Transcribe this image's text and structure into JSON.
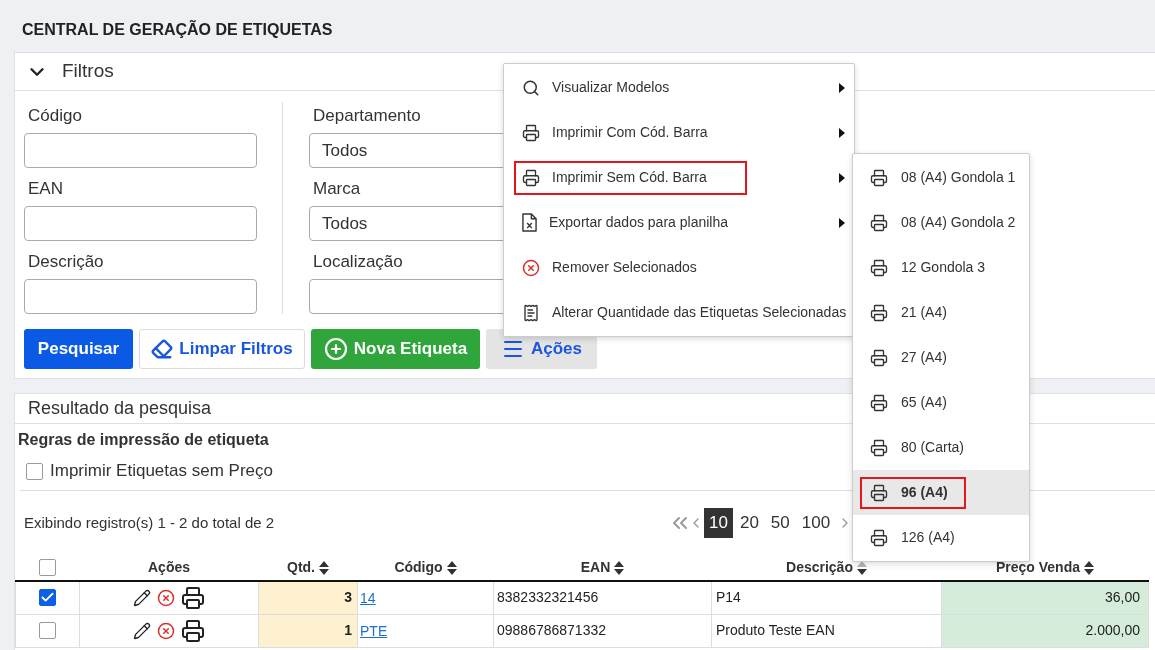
{
  "page": {
    "title": "CENTRAL DE GERAÇÃO DE ETIQUETAS"
  },
  "filters": {
    "title": "Filtros",
    "expanded": true,
    "columns": [
      {
        "fields": [
          {
            "label": "Código",
            "kind": "input"
          },
          {
            "label": "EAN",
            "kind": "input"
          },
          {
            "label": "Descrição",
            "kind": "input"
          }
        ]
      },
      {
        "fields": [
          {
            "label": "Departamento",
            "kind": "select",
            "value": "Todos"
          },
          {
            "label": "Marca",
            "kind": "select",
            "value": "Todos"
          },
          {
            "label": "Localização",
            "kind": "input"
          }
        ]
      }
    ],
    "buttons": [
      {
        "label": "Pesquisar",
        "kind": "search"
      },
      {
        "label": "Limpar Filtros",
        "kind": "clear"
      },
      {
        "label": "Nova Etiqueta",
        "kind": "new"
      },
      {
        "label": "Ações",
        "kind": "menu"
      }
    ]
  },
  "actions_menu": {
    "items": [
      {
        "label": "Visualizar Modelos",
        "kind": "view",
        "submenu": true,
        "outlined": false
      },
      {
        "label": "Imprimir Com Cód. Barra",
        "kind": "print",
        "submenu": true,
        "outlined": false
      },
      {
        "label": "Imprimir Sem Cód. Barra",
        "kind": "print",
        "submenu": true,
        "outlined": true
      },
      {
        "label": "Exportar dados para planilha",
        "kind": "export",
        "submenu": true,
        "outlined": false
      },
      {
        "label": "Remover Selecionados",
        "kind": "remove",
        "submenu": false,
        "outlined": false
      },
      {
        "label": "Alterar Quantidade das Etiquetas Selecionadas",
        "kind": "quantity",
        "submenu": false,
        "outlined": false
      }
    ]
  },
  "submenu": {
    "items": [
      {
        "label": "08 (A4) Gondola 1",
        "selected": false,
        "outlined": false
      },
      {
        "label": "08 (A4) Gondola 2",
        "selected": false,
        "outlined": false
      },
      {
        "label": "12 Gondola 3",
        "selected": false,
        "outlined": false
      },
      {
        "label": "21 (A4)",
        "selected": false,
        "outlined": false
      },
      {
        "label": "27 (A4)",
        "selected": false,
        "outlined": false
      },
      {
        "label": "65 (A4)",
        "selected": false,
        "outlined": false
      },
      {
        "label": "80 (Carta)",
        "selected": false,
        "outlined": false
      },
      {
        "label": "96 (A4)",
        "selected": true,
        "outlined": true
      },
      {
        "label": "126 (A4)",
        "selected": false,
        "outlined": false
      }
    ]
  },
  "results": {
    "title": "Resultado da pesquisa",
    "rules_title": "Regras de impressão de etiqueta",
    "print_without_price": {
      "label": "Imprimir Etiquetas sem Preço",
      "checked": false
    },
    "summary": "Exibindo registro(s) 1 - 2 do total de 2",
    "page_sizes": [
      {
        "label": "10",
        "selected": true
      },
      {
        "label": "20",
        "selected": false
      },
      {
        "label": "50",
        "selected": false
      },
      {
        "label": "100",
        "selected": false
      }
    ],
    "table": {
      "select_all": {
        "checked": false
      },
      "columns": [
        {
          "label": "Ações"
        },
        {
          "label": "Qtd.",
          "sorted": false
        },
        {
          "label": "Código",
          "sorted": false
        },
        {
          "label": "EAN",
          "sorted": false
        },
        {
          "label": "Descrição",
          "sorted": true
        },
        {
          "label": "Preço Venda",
          "sorted": false
        }
      ],
      "rows": [
        {
          "checked": true,
          "qtd": "3",
          "codigo": "14",
          "ean": "8382332321456",
          "descricao": "P14",
          "preco_venda": "36,00"
        },
        {
          "checked": false,
          "qtd": "1",
          "codigo": "PTE",
          "ean": "09886786871332",
          "descricao": "Produto Teste EAN",
          "preco_venda": "2.000,00"
        }
      ]
    }
  }
}
